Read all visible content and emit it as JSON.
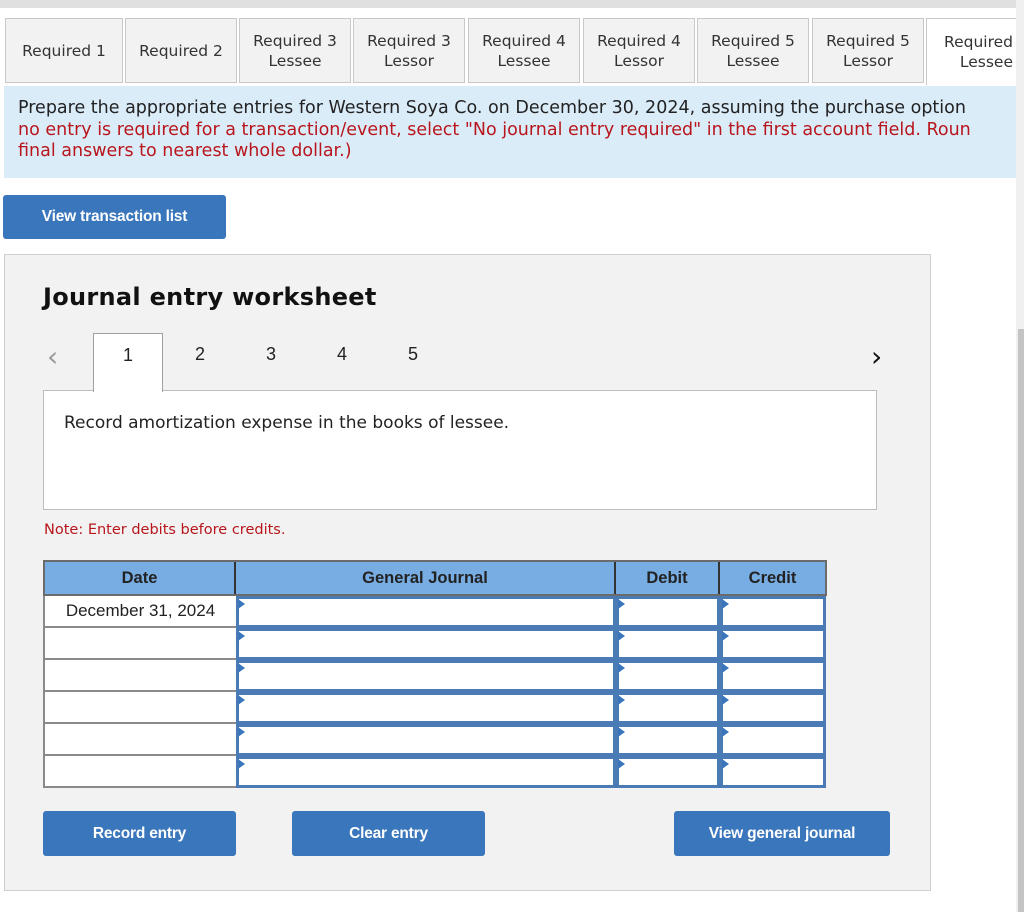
{
  "tabs": [
    {
      "line1": "Required 1",
      "line2": "",
      "active": false
    },
    {
      "line1": "Required 2",
      "line2": "",
      "active": false
    },
    {
      "line1": "Required 3",
      "line2": "Lessee",
      "active": false
    },
    {
      "line1": "Required 3",
      "line2": "Lessor",
      "active": false
    },
    {
      "line1": "Required 4",
      "line2": "Lessee",
      "active": false
    },
    {
      "line1": "Required 4",
      "line2": "Lessor",
      "active": false
    },
    {
      "line1": "Required 5",
      "line2": "Lessee",
      "active": false
    },
    {
      "line1": "Required 5",
      "line2": "Lessor",
      "active": false
    },
    {
      "line1": "Required",
      "line2": "Lessee",
      "active": true
    }
  ],
  "instructions": {
    "line1": "Prepare the appropriate entries for Western Soya Co. on December 30, 2024, assuming the purchase option",
    "line2": "no entry is required for a transaction/event, select \"No journal entry required\" in the first account field. Roun",
    "line3": "final answers to nearest whole dollar.)"
  },
  "view_transaction_list": "View transaction list",
  "worksheet": {
    "title": "Journal entry worksheet",
    "prev_icon": "‹",
    "next_icon": "›",
    "entry_tabs": [
      "1",
      "2",
      "3",
      "4",
      "5"
    ],
    "active_entry": "1",
    "description": "Record amortization expense in the books of lessee.",
    "note": "Note: Enter debits before credits.",
    "columns": [
      "Date",
      "General Journal",
      "Debit",
      "Credit"
    ],
    "rows": [
      {
        "date": "December 31, 2024",
        "account": "",
        "debit": "",
        "credit": ""
      },
      {
        "date": "",
        "account": "",
        "debit": "",
        "credit": ""
      },
      {
        "date": "",
        "account": "",
        "debit": "",
        "credit": ""
      },
      {
        "date": "",
        "account": "",
        "debit": "",
        "credit": ""
      },
      {
        "date": "",
        "account": "",
        "debit": "",
        "credit": ""
      },
      {
        "date": "",
        "account": "",
        "debit": "",
        "credit": ""
      }
    ],
    "buttons": {
      "record": "Record entry",
      "clear": "Clear entry",
      "view_journal": "View general journal"
    }
  },
  "colors": {
    "button_blue": "#3a76bb",
    "header_blue": "#78ade3",
    "instruction_bg": "#dbecf9",
    "alert_red": "#b8161c"
  }
}
